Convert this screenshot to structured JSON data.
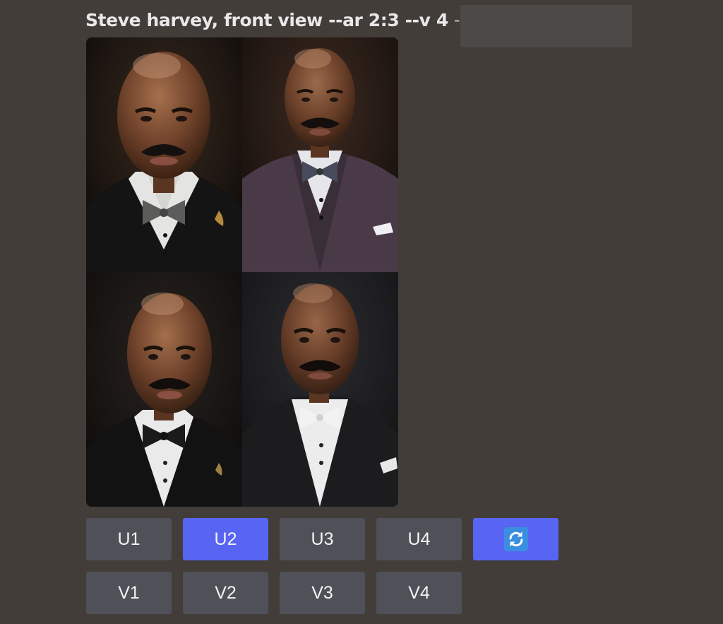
{
  "message": {
    "prompt": "Steve harvey, front view --ar 2:3 --v 4",
    "separator": "-"
  },
  "image_grid": {
    "images": [
      {
        "alt": "Portrait 1",
        "suit": "black tuxedo, silver bow tie",
        "background": "dark"
      },
      {
        "alt": "Portrait 2",
        "suit": "purple suit, patterned bow tie",
        "background": "dark brown"
      },
      {
        "alt": "Portrait 3",
        "suit": "black tuxedo, black bow tie",
        "background": "dark"
      },
      {
        "alt": "Portrait 4",
        "suit": "black tuxedo, white bow tie",
        "background": "dark gray"
      }
    ]
  },
  "actions": {
    "upscale": [
      "U1",
      "U2",
      "U3",
      "U4"
    ],
    "variation": [
      "V1",
      "V2",
      "V3",
      "V4"
    ],
    "selected": "U2",
    "reroll_icon": "refresh-icon"
  },
  "colors": {
    "background": "#423d38",
    "button": "#4f5058",
    "button_active": "#5865f2",
    "reroll_icon_bg": "#3a8ee0"
  }
}
